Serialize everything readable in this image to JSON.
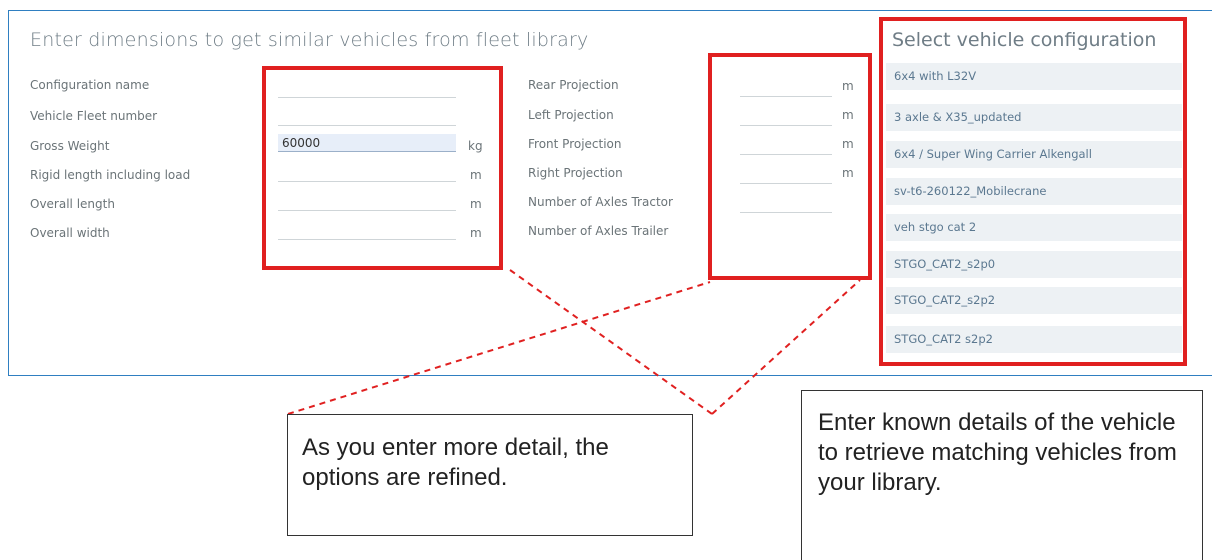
{
  "form": {
    "title": "Enter dimensions to get similar vehicles from fleet library",
    "left_fields": [
      {
        "label": "Configuration name",
        "value": "",
        "unit": ""
      },
      {
        "label": "Vehicle Fleet number",
        "value": "",
        "unit": ""
      },
      {
        "label": "Gross Weight",
        "value": "60000",
        "unit": "kg"
      },
      {
        "label": "Rigid length including load",
        "value": "",
        "unit": "m"
      },
      {
        "label": "Overall length",
        "value": "",
        "unit": "m"
      },
      {
        "label": "Overall width",
        "value": "",
        "unit": "m"
      }
    ],
    "right_fields": [
      {
        "label": "Rear Projection",
        "value": "",
        "unit": "m"
      },
      {
        "label": "Left Projection",
        "value": "",
        "unit": "m"
      },
      {
        "label": "Front Projection",
        "value": "",
        "unit": "m"
      },
      {
        "label": "Right Projection",
        "value": "",
        "unit": "m"
      },
      {
        "label": "Number of Axles Tractor",
        "value": "",
        "unit": ""
      },
      {
        "label": "Number of Axles Trailer",
        "value": "",
        "unit": ""
      }
    ]
  },
  "config": {
    "title": "Select vehicle configuration",
    "items": [
      "6x4 with L32V",
      "3 axle & X35_updated",
      "6x4 / Super Wing Carrier  Alkengall",
      "sv-t6-260122_Mobilecrane",
      "veh stgo cat 2",
      "STGO_CAT2_s2p0",
      "STGO_CAT2_s2p2",
      "STGO_CAT2 s2p2"
    ]
  },
  "callouts": {
    "left": "As you enter more detail, the options are refined.",
    "right": "Enter known details of the vehicle to retrieve matching vehicles from your library."
  },
  "colors": {
    "highlight_red": "#e02020",
    "panel_border": "#2f7fc1",
    "list_bg": "#edf1f4"
  }
}
